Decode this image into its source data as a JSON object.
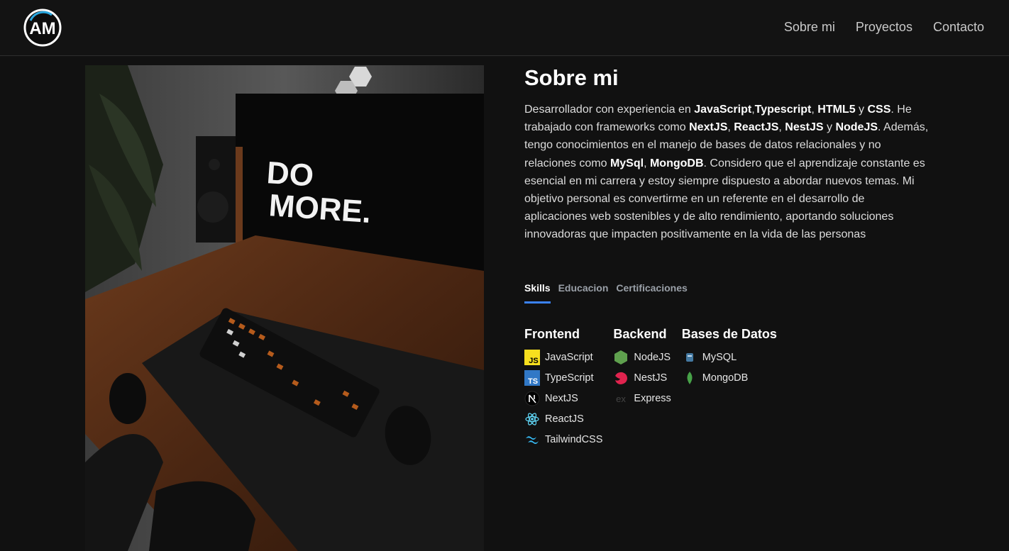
{
  "header": {
    "logo_text": "AM",
    "nav": [
      "Sobre mi",
      "Proyectos",
      "Contacto"
    ]
  },
  "hero_image": {
    "screen_text_line1": "DO",
    "screen_text_line2": "MORE."
  },
  "about": {
    "title": "Sobre mi",
    "bio": [
      {
        "t": "Desarrollador con experiencia en "
      },
      {
        "t": "JavaScript",
        "b": true
      },
      {
        "t": ","
      },
      {
        "t": "Typescript",
        "b": true
      },
      {
        "t": ", "
      },
      {
        "t": "HTML5",
        "b": true
      },
      {
        "t": " y "
      },
      {
        "t": "CSS",
        "b": true
      },
      {
        "t": ". He trabajado con frameworks como "
      },
      {
        "t": "NextJS",
        "b": true
      },
      {
        "t": ", "
      },
      {
        "t": "ReactJS",
        "b": true
      },
      {
        "t": ", "
      },
      {
        "t": "NestJS",
        "b": true
      },
      {
        "t": " y "
      },
      {
        "t": "NodeJS",
        "b": true
      },
      {
        "t": ". Además, tengo conocimientos en el manejo de bases de datos relacionales y no relaciones como "
      },
      {
        "t": "MySql",
        "b": true
      },
      {
        "t": ", "
      },
      {
        "t": "MongoDB",
        "b": true
      },
      {
        "t": ". Considero que el aprendizaje constante es esencial en mi carrera y estoy siempre dispuesto a abordar nuevos temas. Mi objetivo personal es convertirme en un referente en el desarrollo de aplicaciones web sostenibles y de alto rendimiento, aportando soluciones innovadoras que impacten positivamente en la vida de las personas"
      }
    ]
  },
  "tabs": {
    "items": [
      "Skills",
      "Educacion",
      "Certificaciones"
    ],
    "active": "Skills",
    "accent": "#3b82f6"
  },
  "skills": {
    "frontend": {
      "title": "Frontend",
      "items": [
        {
          "label": "JavaScript",
          "icon": "javascript-icon"
        },
        {
          "label": "TypeScript",
          "icon": "typescript-icon"
        },
        {
          "label": "NextJS",
          "icon": "nextjs-icon"
        },
        {
          "label": "ReactJS",
          "icon": "react-icon"
        },
        {
          "label": "TailwindCSS",
          "icon": "tailwind-icon"
        }
      ]
    },
    "backend": {
      "title": "Backend",
      "items": [
        {
          "label": "NodeJS",
          "icon": "nodejs-icon"
        },
        {
          "label": "NestJS",
          "icon": "nestjs-icon"
        },
        {
          "label": "Express",
          "icon": "express-icon"
        }
      ]
    },
    "databases": {
      "title": "Bases de Datos",
      "items": [
        {
          "label": "MySQL",
          "icon": "mysql-icon"
        },
        {
          "label": "MongoDB",
          "icon": "mongodb-icon"
        }
      ]
    }
  }
}
